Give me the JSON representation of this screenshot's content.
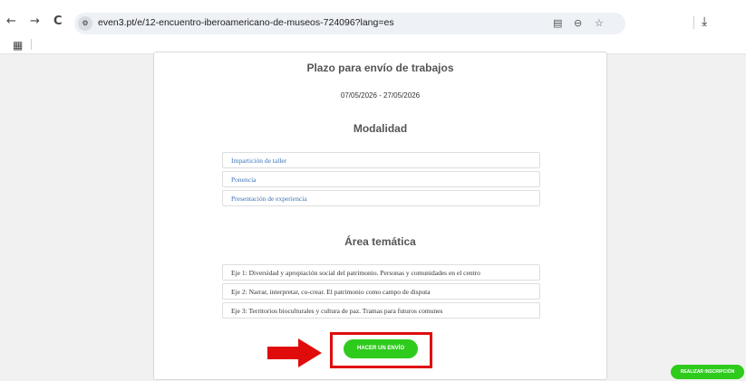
{
  "browser": {
    "back_icon": "←",
    "forward_icon": "→",
    "reload_icon": "C",
    "site_info_icon": "⚙",
    "url": "even3.pt/e/12-encuentro-iberoamericano-de-museos-724096?lang=es",
    "translate_icon": "▤",
    "zoom_icon": "⊖",
    "bookmark_icon": "☆",
    "download_icon": "⤓",
    "apps_icon": "▦"
  },
  "submission": {
    "title": "Plazo para envío de trabajos",
    "dates": "07/05/2026 - 27/05/2026"
  },
  "modality": {
    "title": "Modalidad",
    "items": [
      "Impartición de taller",
      "Ponencia",
      "Presentación de experiencia"
    ]
  },
  "thematic": {
    "title": "Área temática",
    "items": [
      "Eje 1: Diversidad y apropiación social del patrimonio. Personas y comunidades en el centro",
      "Eje 2: Narrar, interpretar, co-crear. El patrimonio como campo de disputa",
      "Eje 3: Territorios bioculturales y cultura de paz. Tramas para futuros comunes"
    ]
  },
  "actions": {
    "submit_label": "HACER UN ENVÍO",
    "register_label": "REALIZAR INSCRIPCIÓN"
  },
  "colors": {
    "accent_green": "#2ecb1c",
    "highlight_red": "#e00c0c",
    "link_blue": "#3c73b4"
  }
}
